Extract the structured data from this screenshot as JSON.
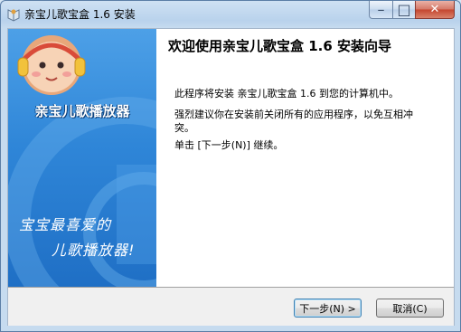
{
  "window": {
    "title": "亲宝儿歌宝盒 1.6 安装"
  },
  "caption": {
    "minimize": "–",
    "maximize": "□",
    "close": "✕"
  },
  "sidebar": {
    "app_name": "亲宝儿歌播放器",
    "slogan_line1": "宝宝最喜爱的",
    "slogan_line2": "儿歌播放器!"
  },
  "content": {
    "heading": "欢迎使用亲宝儿歌宝盒 1.6 安装向导",
    "para1": "此程序将安装 亲宝儿歌宝盒 1.6 到您的计算机中。",
    "para2": " 强烈建议你在安装前关闭所有的应用程序，以免互相冲突。",
    "para3": "单击 [下一步(N)] 继续。"
  },
  "buttons": {
    "next": "下一步(N) >",
    "cancel": "取消(C)"
  },
  "colors": {
    "sidebar": "#2f86d8",
    "accent": "#3c7fb1"
  }
}
